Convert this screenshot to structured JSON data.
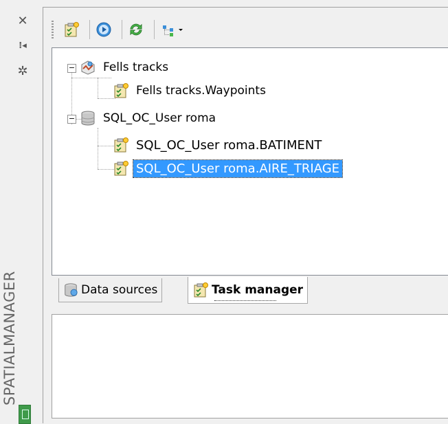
{
  "palette": {
    "title": "SPATIALMANAGER",
    "buttons": [
      {
        "name": "close-icon",
        "glyph": "✕"
      },
      {
        "name": "auto-hide-icon",
        "glyph": "⁞◂"
      },
      {
        "name": "properties-icon",
        "glyph": "✲"
      }
    ]
  },
  "toolbar": {
    "buttons": [
      {
        "name": "task-icon"
      },
      {
        "name": "run-icon"
      },
      {
        "name": "refresh-icon"
      },
      {
        "name": "tree-view-icon"
      }
    ]
  },
  "tree": {
    "nodes": [
      {
        "label": "Fells tracks",
        "expander": "−",
        "icon": "gps-icon"
      },
      {
        "label": "Fells tracks.Waypoints",
        "icon": "task-icon"
      },
      {
        "label": "SQL_OC_User roma",
        "expander": "−",
        "icon": "database-icon"
      },
      {
        "label": "SQL_OC_User roma.BATIMENT",
        "icon": "task-icon"
      },
      {
        "label": "SQL_OC_User roma.AIRE_TRIAGE",
        "icon": "task-icon",
        "selected": true
      }
    ]
  },
  "tabs": [
    {
      "label": "Data sources",
      "active": false
    },
    {
      "label": "Task manager",
      "active": true
    }
  ],
  "colors": {
    "selection": "#3399ff",
    "logo": "#3f9a4a"
  }
}
